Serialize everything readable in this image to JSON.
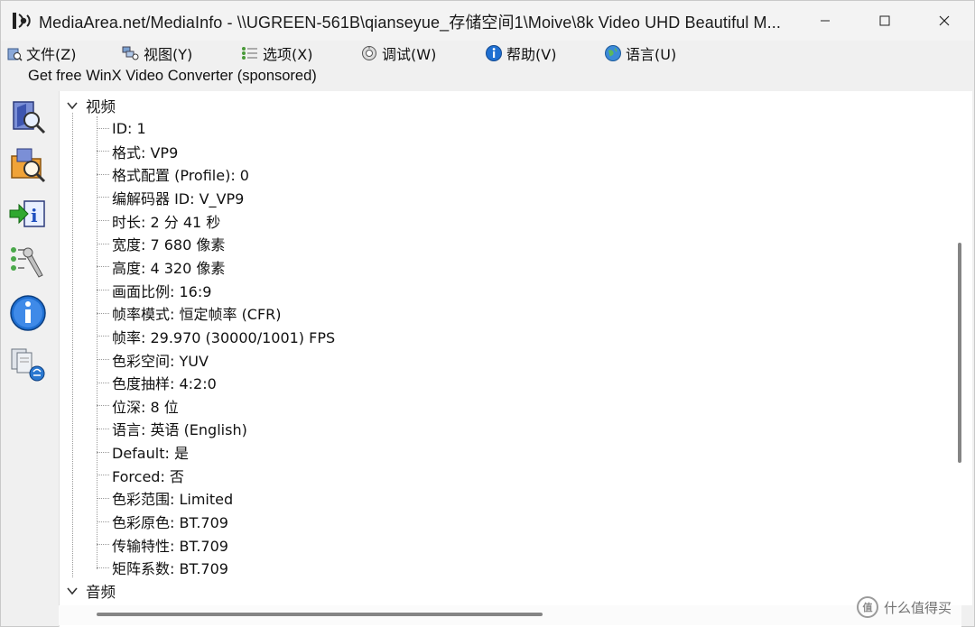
{
  "window": {
    "title": "MediaArea.net/MediaInfo - \\\\UGREEN-561B\\qianseyue_存储空间1\\Moive\\8k Video UHD Beautiful M..."
  },
  "menu": [
    {
      "label": "文件(Z)",
      "icon": "folder-file-icon"
    },
    {
      "label": "视图(Y)",
      "icon": "view-icon"
    },
    {
      "label": "选项(X)",
      "icon": "options-icon"
    },
    {
      "label": "调试(W)",
      "icon": "debug-icon"
    },
    {
      "label": "帮助(V)",
      "icon": "help-icon"
    },
    {
      "label": "语言(U)",
      "icon": "language-icon"
    }
  ],
  "sponsor_link": "Get free WinX Video Converter (sponsored)",
  "toolbar": [
    {
      "name": "open-file-icon"
    },
    {
      "name": "open-folder-icon"
    },
    {
      "name": "export-info-icon"
    },
    {
      "name": "settings-wrench-icon"
    },
    {
      "name": "about-info-icon"
    },
    {
      "name": "web-update-icon"
    }
  ],
  "tree": {
    "video_header": "视频",
    "video_rows": [
      "ID: 1",
      "格式: VP9",
      "格式配置 (Profile): 0",
      "编解码器 ID: V_VP9",
      "时长: 2 分 41 秒",
      "宽度: 7 680 像素",
      "高度: 4 320 像素",
      "画面比例: 16:9",
      "帧率模式: 恒定帧率 (CFR)",
      "帧率: 29.970 (30000/1001) FPS",
      "色彩空间: YUV",
      "色度抽样: 4:2:0",
      "位深: 8 位",
      "语言: 英语 (English)",
      "Default: 是",
      "Forced: 否",
      "色彩范围: Limited",
      "色彩原色: BT.709",
      "传输特性: BT.709",
      "矩阵系数: BT.709"
    ],
    "audio_header": "音频"
  },
  "watermark": {
    "logo": "值",
    "text": "什么值得买"
  },
  "colors": {
    "accent_blue": "#1f6fd1",
    "tree_dots": "#9a9a9a",
    "panel_bg": "#ffffff"
  }
}
